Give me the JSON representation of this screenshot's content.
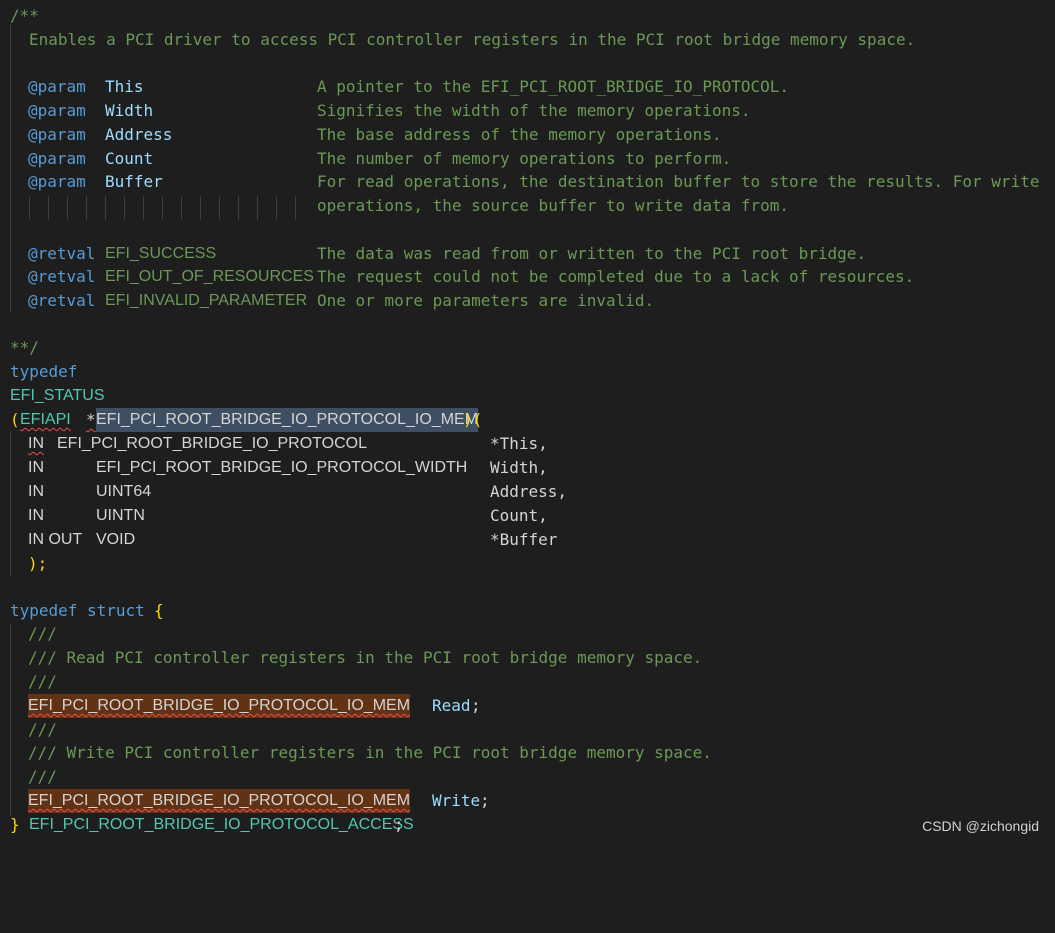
{
  "comment": {
    "open": "/**",
    "summary": "Enables a PCI driver to access PCI controller registers in the PCI root bridge memory space.",
    "params": [
      {
        "tag": "@param",
        "name": "This",
        "desc": "A pointer to the EFI_PCI_ROOT_BRIDGE_IO_PROTOCOL."
      },
      {
        "tag": "@param",
        "name": "Width",
        "desc": "Signifies the width of the memory operations."
      },
      {
        "tag": "@param",
        "name": "Address",
        "desc": "The base address of the memory operations."
      },
      {
        "tag": "@param",
        "name": "Count",
        "desc": "The number of memory operations to perform."
      },
      {
        "tag": "@param",
        "name": "Buffer",
        "desc": "For read operations, the destination buffer to store the results. For write",
        "desc2": "operations, the source buffer to write data from."
      }
    ],
    "retvals": [
      {
        "tag": "@retval",
        "name": "EFI_SUCCESS",
        "desc": "The data was read from or written to the PCI root bridge."
      },
      {
        "tag": "@retval",
        "name": "EFI_OUT_OF_RESOURCES",
        "desc": "The request could not be completed due to a lack of resources."
      },
      {
        "tag": "@retval",
        "name": "EFI_INVALID_PARAMETER",
        "desc": "One or more parameters are invalid."
      }
    ],
    "close": "**/"
  },
  "typedef1": {
    "kw_typedef": "typedef",
    "ret_type": "EFI_STATUS",
    "open_paren": "(",
    "efiapi": "EFIAPI",
    "star": "*",
    "func_name": "EFI_PCI_ROOT_BRIDGE_IO_PROTOCOL_IO_MEM",
    "open_paren2": ")(",
    "args": [
      {
        "mods": "IN",
        "type": "EFI_PCI_ROOT_BRIDGE_IO_PROTOCOL",
        "name": "*This,"
      },
      {
        "mods": "IN",
        "type": "EFI_PCI_ROOT_BRIDGE_IO_PROTOCOL_WIDTH",
        "name": "Width,"
      },
      {
        "mods": "IN",
        "type": "UINT64",
        "name": "Address,"
      },
      {
        "mods": "IN",
        "type": "UINTN",
        "name": "Count,"
      },
      {
        "mods": "IN OUT",
        "type": "VOID",
        "name": "*Buffer"
      }
    ],
    "close": ");"
  },
  "typedef2": {
    "kw_typedef": "typedef",
    "kw_struct": "struct",
    "open_brace": "{",
    "doc_marker": "///",
    "read_comment": "/// Read PCI controller registers in the PCI root bridge memory space.",
    "write_comment": "/// Write PCI controller registers in the PCI root bridge memory space.",
    "member_type": "EFI_PCI_ROOT_BRIDGE_IO_PROTOCOL_IO_MEM",
    "read_name": "Read",
    "write_name": "Write",
    "semicolon": ";",
    "close_brace": "}",
    "struct_name": "EFI_PCI_ROOT_BRIDGE_IO_PROTOCOL_ACCESS"
  },
  "watermark": "CSDN @zichongid"
}
